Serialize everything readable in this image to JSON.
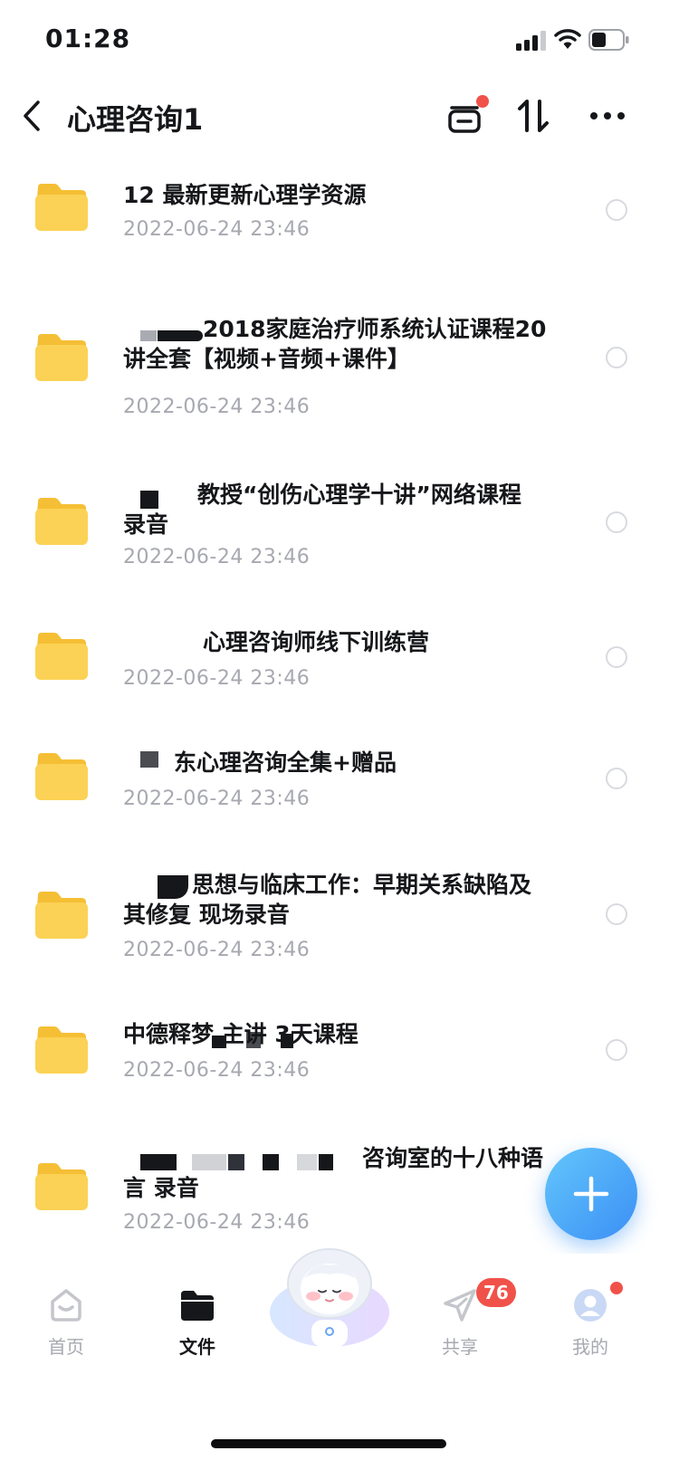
{
  "status_bar": {
    "time": "01:28"
  },
  "nav": {
    "title": "心理咨询1"
  },
  "files": [
    {
      "name": "12 最新更新心理学资源",
      "date": "2022-06-24 23:46"
    },
    {
      "name": "2018家庭治疗师系统认证课程20讲全套【视频+音频+课件】",
      "date": "2022-06-24 23:46"
    },
    {
      "name": "教授“创伤心理学十讲”网络课程 录音",
      "date": "2022-06-24 23:46"
    },
    {
      "name": "心理咨询师线下训练营",
      "date": "2022-06-24 23:46"
    },
    {
      "name": "东心理咨询全集+赠品",
      "date": "2022-06-24 23:46"
    },
    {
      "name": "思想与临床工作：早期关系缺陷及其修复 现场录音",
      "date": "2022-06-24 23:46"
    },
    {
      "name": "中德释梦 主讲 3天课程",
      "date": "2022-06-24 23:46"
    },
    {
      "name": "咨询室的十八种语言 录音",
      "date": "2022-06-24 23:46"
    }
  ],
  "tabs": [
    {
      "label": "首页",
      "icon": "home-icon"
    },
    {
      "label": "文件",
      "icon": "folder-icon"
    },
    {
      "label": "共享",
      "icon": "paper-plane-icon"
    },
    {
      "label": "我的",
      "icon": "avatar-icon"
    }
  ],
  "share_badge": "76",
  "colors": {
    "accent": "#3c8ff5",
    "badge": "#f0524a",
    "folder": "#f9cd4e",
    "muted_text": "#a7a9b0"
  }
}
